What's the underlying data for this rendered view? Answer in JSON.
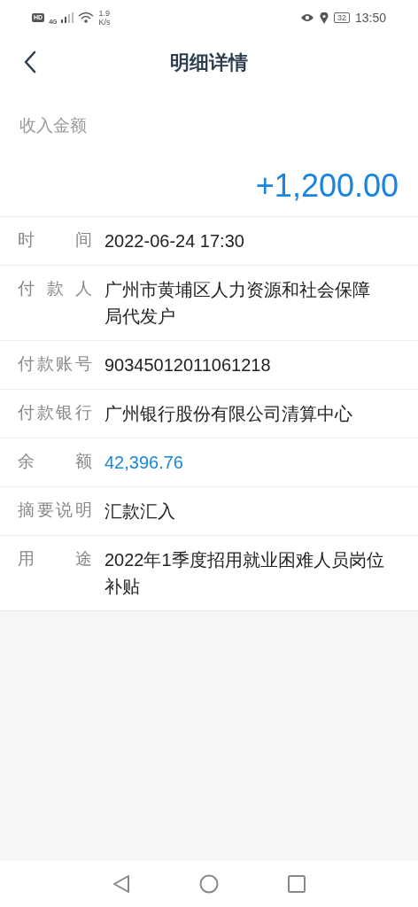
{
  "status_bar": {
    "hd": "HD",
    "network": "4G",
    "speed": "1.9",
    "speed_unit": "K/s",
    "battery": "32",
    "time": "13:50"
  },
  "header": {
    "title": "明细详情"
  },
  "amount": {
    "label": "收入金额",
    "value": "+1,200.00"
  },
  "details": [
    {
      "label": "时间",
      "value": "2022-06-24 17:30",
      "kind": "text"
    },
    {
      "label": "付款人",
      "value": "广州市黄埔区人力资源和社会保障局代发户",
      "kind": "text"
    },
    {
      "label": "付款账号",
      "value": "90345012011061218",
      "kind": "text"
    },
    {
      "label": "付款银行",
      "value": "广州银行股份有限公司清算中心",
      "kind": "text"
    },
    {
      "label": "余额",
      "value": "42,396.76",
      "kind": "money"
    },
    {
      "label": "摘要说明",
      "value": "汇款汇入",
      "kind": "text"
    },
    {
      "label": "用途",
      "value": "2022年1季度招用就业困难人员岗位补贴",
      "kind": "text"
    }
  ]
}
